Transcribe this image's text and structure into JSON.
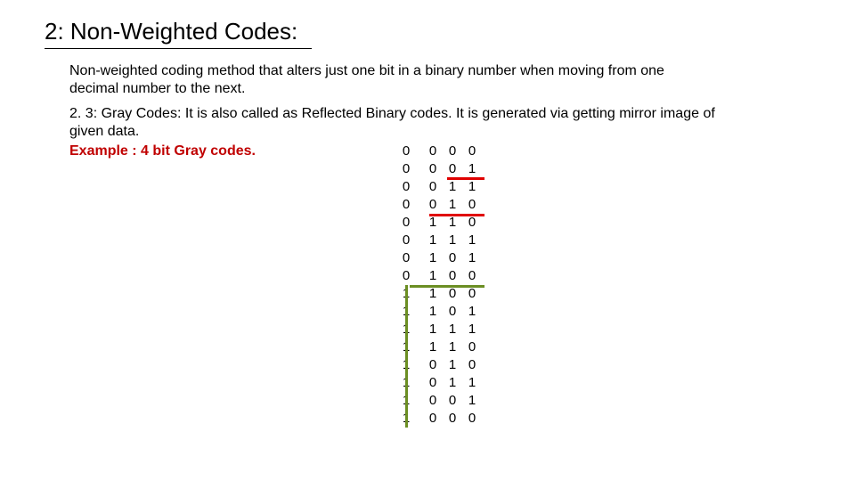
{
  "title": "2: Non-Weighted Codes:",
  "paragraph1": "Non-weighted coding method that alters just one bit in a binary number when moving from one decimal number to the next.",
  "paragraph2": "2. 3: Gray Codes:  It is also called as Reflected Binary codes. It is generated via getting mirror image of given data.",
  "example_label": "Example : 4 bit Gray codes.",
  "gray_codes": [
    [
      "0",
      "0",
      "0",
      "0"
    ],
    [
      "0",
      "0",
      "0",
      "1"
    ],
    [
      "0",
      "0",
      "1",
      "1"
    ],
    [
      "0",
      "0",
      "1",
      "0"
    ],
    [
      "0",
      "1",
      "1",
      "0"
    ],
    [
      "0",
      "1",
      "1",
      "1"
    ],
    [
      "0",
      "1",
      "0",
      "1"
    ],
    [
      "0",
      "1",
      "0",
      "0"
    ],
    [
      "1",
      "1",
      "0",
      "0"
    ],
    [
      "1",
      "1",
      "0",
      "1"
    ],
    [
      "1",
      "1",
      "1",
      "1"
    ],
    [
      "1",
      "1",
      "1",
      "0"
    ],
    [
      "1",
      "0",
      "1",
      "0"
    ],
    [
      "1",
      "0",
      "1",
      "1"
    ],
    [
      "1",
      "0",
      "0",
      "1"
    ],
    [
      "1",
      "0",
      "0",
      "0"
    ]
  ]
}
